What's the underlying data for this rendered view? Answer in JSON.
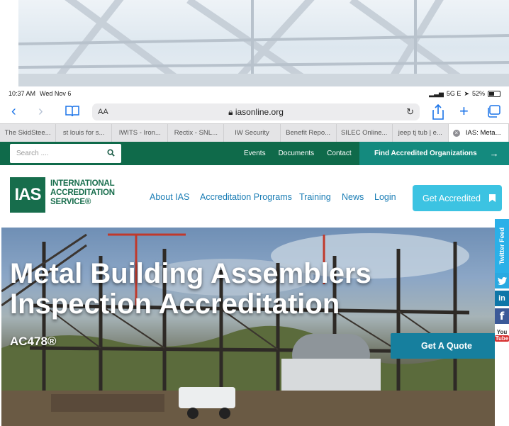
{
  "status_bar": {
    "time": "10:37 AM",
    "date": "Wed Nov 6",
    "network": "5G E",
    "battery_percent": "52%",
    "battery_level": 0.52
  },
  "browser": {
    "text_size_label": "AA",
    "url": "iasonline.org",
    "tabs": [
      {
        "label": "The SkidStee..."
      },
      {
        "label": "st louis for s..."
      },
      {
        "label": "IWITS - Iron..."
      },
      {
        "label": "Rectix - SNL..."
      },
      {
        "label": "IW Security"
      },
      {
        "label": "Benefit Repo..."
      },
      {
        "label": "SILEC Online..."
      },
      {
        "label": "jeep tj tub | e..."
      },
      {
        "label": "IAS: Meta...",
        "active": true
      }
    ]
  },
  "site": {
    "search": {
      "placeholder": "Search ...."
    },
    "top_links": [
      "Events",
      "Documents",
      "Contact"
    ],
    "find_button": "Find Accredited Organizations",
    "logo": {
      "mark": "IAS",
      "line1": "INTERNATIONAL",
      "line2": "ACCREDITATION",
      "line3": "SERVICE®"
    },
    "nav": [
      "About IAS",
      "Accreditation Programs",
      "Training",
      "News",
      "Login"
    ],
    "cta": "Get Accredited",
    "hero": {
      "title_line1": "Metal Building Assemblers",
      "title_line2": "Inspection Accreditation",
      "subtitle": "AC478®",
      "quote_button": "Get A Quote"
    },
    "social": {
      "twitter_feed": "Twitter Feed",
      "linkedin": "in",
      "facebook": "f",
      "youtube_you": "You",
      "youtube_tube": "Tube"
    }
  },
  "colors": {
    "ias_green": "#0f6a4a",
    "find_teal": "#148a7e",
    "nav_blue": "#1a7db5",
    "cta_cyan": "#3cc3e2",
    "quote_blue": "#167f9e",
    "safari_blue": "#1a73e8"
  }
}
